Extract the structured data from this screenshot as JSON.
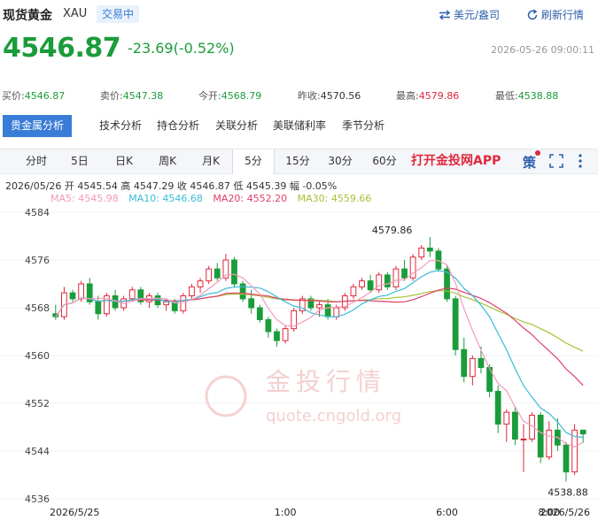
{
  "header": {
    "title": "现货黄金",
    "code": "XAU",
    "status": "交易中",
    "unit_button": "美元/盎司",
    "refresh_button": "刷新行情"
  },
  "price": {
    "last": "4546.87",
    "change": "-23.69(-0.52%)",
    "datetime": "2026-05-26 09:00:11"
  },
  "quote": {
    "bid_label": "买价:",
    "bid": "4546.87",
    "ask_label": "卖价:",
    "ask": "4547.38",
    "open_label": "今开:",
    "open": "4568.79",
    "prev_label": "昨收:",
    "prev": "4570.56",
    "high_label": "最高:",
    "high": "4579.86",
    "low_label": "最低:",
    "low": "4538.88"
  },
  "tabs_main": [
    "贵金属分析",
    "技术分析",
    "持仓分析",
    "关联分析",
    "美联储利率",
    "季节分析"
  ],
  "tabs_period": [
    "分时",
    "5日",
    "日K",
    "周K",
    "月K",
    "5分",
    "15分",
    "30分",
    "60分"
  ],
  "active_period": "5分",
  "app_link": "打开金投网APP",
  "tools": {
    "strategy": "策",
    "fullscreen_icon": "fullscreen-icon",
    "more_icon": "more-vertical-icon"
  },
  "ohlc_line": "2026/05/26  开 4545.54  高 4547.29  收 4546.87  低 4545.39  幅 -0.05%",
  "ma": {
    "ma5": "MA5: 4545.98",
    "ma10": "MA10: 4546.68",
    "ma20": "MA20: 4552.20",
    "ma30": "MA30: 4559.66"
  },
  "colors": {
    "up": "#e0283c",
    "down": "#1a9c3a",
    "brand": "#3a7dd6",
    "ma5": "#f29bb8",
    "ma10": "#3bbbd8",
    "ma20": "#e0406a",
    "ma30": "#a6c23a"
  },
  "watermark": {
    "cn": "金投行情",
    "url": "quote.cngold.org"
  },
  "chart_data": {
    "type": "candlestick",
    "ylim": [
      4536,
      4584
    ],
    "yticks": [
      4584,
      4576,
      4568,
      4560,
      4552,
      4544,
      4536
    ],
    "xticks": [
      "2026/5/25",
      "1:00",
      "6:00",
      "8:00",
      "2026/5/26"
    ],
    "annotations": {
      "high": "4579.86",
      "low": "4538.88"
    },
    "candles": [
      [
        4567.0,
        4568.5,
        4566.0,
        4566.5
      ],
      [
        4566.5,
        4571.5,
        4566.0,
        4570.5
      ],
      [
        4570.5,
        4571.0,
        4569.0,
        4569.5
      ],
      [
        4569.5,
        4572.5,
        4569.0,
        4572.0
      ],
      [
        4572.0,
        4573.0,
        4568.5,
        4569.0
      ],
      [
        4569.0,
        4570.0,
        4566.0,
        4567.0
      ],
      [
        4567.0,
        4570.5,
        4566.5,
        4570.0
      ],
      [
        4570.0,
        4571.0,
        4567.5,
        4568.0
      ],
      [
        4568.0,
        4570.0,
        4567.5,
        4569.5
      ],
      [
        4569.5,
        4571.5,
        4569.0,
        4571.0
      ],
      [
        4571.0,
        4571.5,
        4568.5,
        4569.0
      ],
      [
        4569.0,
        4570.5,
        4568.0,
        4570.0
      ],
      [
        4570.0,
        4570.5,
        4568.0,
        4568.5
      ],
      [
        4568.5,
        4569.5,
        4567.5,
        4569.0
      ],
      [
        4569.0,
        4569.5,
        4567.0,
        4567.5
      ],
      [
        4567.5,
        4570.5,
        4567.0,
        4570.0
      ],
      [
        4570.0,
        4572.0,
        4569.5,
        4571.5
      ],
      [
        4571.5,
        4573.0,
        4570.5,
        4572.5
      ],
      [
        4572.5,
        4575.0,
        4572.0,
        4574.5
      ],
      [
        4574.5,
        4575.5,
        4572.5,
        4573.0
      ],
      [
        4573.0,
        4577.0,
        4572.5,
        4576.0
      ],
      [
        4576.0,
        4576.5,
        4571.5,
        4572.0
      ],
      [
        4572.0,
        4572.5,
        4569.0,
        4569.5
      ],
      [
        4569.5,
        4571.0,
        4567.0,
        4568.0
      ],
      [
        4568.0,
        4568.5,
        4565.5,
        4566.0
      ],
      [
        4566.0,
        4566.5,
        4563.0,
        4564.0
      ],
      [
        4564.0,
        4564.5,
        4561.5,
        4562.5
      ],
      [
        4562.5,
        4565.0,
        4562.0,
        4564.5
      ],
      [
        4564.5,
        4568.0,
        4564.0,
        4567.5
      ],
      [
        4567.5,
        4570.0,
        4567.0,
        4569.5
      ],
      [
        4569.5,
        4570.0,
        4567.5,
        4568.0
      ],
      [
        4568.0,
        4569.0,
        4566.5,
        4568.5
      ],
      [
        4568.5,
        4569.5,
        4566.0,
        4566.5
      ],
      [
        4566.5,
        4568.5,
        4566.0,
        4568.0
      ],
      [
        4568.0,
        4570.5,
        4567.5,
        4570.0
      ],
      [
        4570.0,
        4572.0,
        4569.5,
        4571.5
      ],
      [
        4571.5,
        4573.0,
        4571.0,
        4572.5
      ],
      [
        4572.5,
        4573.5,
        4570.5,
        4571.0
      ],
      [
        4571.0,
        4574.0,
        4570.5,
        4573.5
      ],
      [
        4573.5,
        4574.0,
        4571.0,
        4571.5
      ],
      [
        4571.5,
        4575.0,
        4571.0,
        4574.5
      ],
      [
        4574.5,
        4576.0,
        4572.5,
        4573.0
      ],
      [
        4573.0,
        4577.0,
        4572.5,
        4576.5
      ],
      [
        4576.5,
        4578.5,
        4576.0,
        4578.0
      ],
      [
        4578.0,
        4579.86,
        4576.5,
        4577.5
      ],
      [
        4577.5,
        4578.0,
        4574.0,
        4574.5
      ],
      [
        4574.5,
        4575.0,
        4569.0,
        4569.5
      ],
      [
        4569.5,
        4570.0,
        4560.0,
        4561.0
      ],
      [
        4561.0,
        4563.0,
        4555.5,
        4556.5
      ],
      [
        4556.5,
        4560.0,
        4555.0,
        4559.5
      ],
      [
        4559.5,
        4561.5,
        4557.0,
        4558.0
      ],
      [
        4558.0,
        4558.5,
        4553.0,
        4554.0
      ],
      [
        4554.0,
        4555.0,
        4547.0,
        4548.5
      ],
      [
        4548.5,
        4551.0,
        4545.5,
        4550.5
      ],
      [
        4550.5,
        4551.5,
        4545.0,
        4546.0
      ],
      [
        4546.0,
        4548.5,
        4540.5,
        4546.0
      ],
      [
        4546.0,
        4550.5,
        4545.5,
        4550.0
      ],
      [
        4550.0,
        4550.5,
        4542.0,
        4543.0
      ],
      [
        4543.0,
        4549.0,
        4542.5,
        4547.5
      ],
      [
        4547.5,
        4549.5,
        4544.0,
        4545.0
      ],
      [
        4545.0,
        4545.5,
        4538.88,
        4540.5
      ],
      [
        4540.5,
        4548.5,
        4540.0,
        4547.5
      ],
      [
        4547.5,
        4547.5,
        4545.39,
        4546.87
      ]
    ]
  }
}
